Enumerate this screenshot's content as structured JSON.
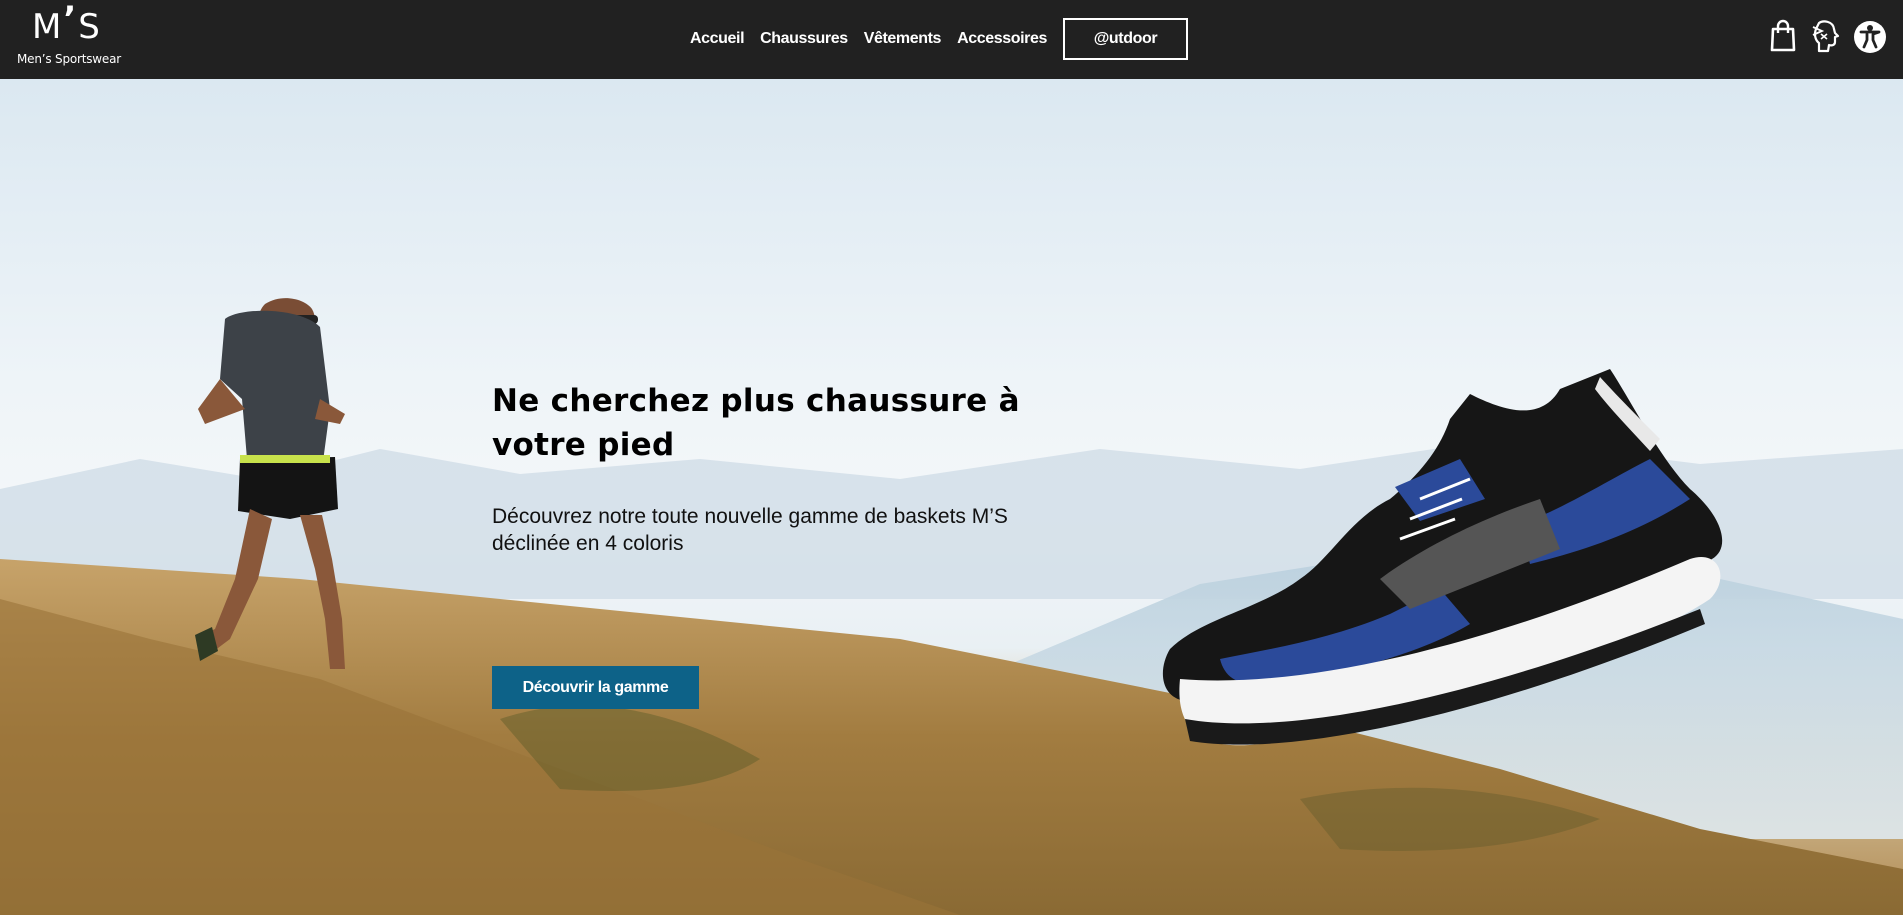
{
  "brand": {
    "mark_left": "M",
    "mark_quote": "’",
    "mark_right": "S",
    "tagline": "Men’s Sportswear"
  },
  "nav": {
    "items": [
      {
        "label": "Accueil"
      },
      {
        "label": "Chaussures"
      },
      {
        "label": "Vêtements"
      },
      {
        "label": "Accessoires"
      }
    ],
    "outdoor_label": "@utdoor"
  },
  "icons": [
    "shopping-bag-icon",
    "profile-icon",
    "accessibility-icon"
  ],
  "hero": {
    "headline": "Ne cherchez plus chaussure à votre pied",
    "subtext": "Découvrez notre toute nouvelle gamme de baskets M’S déclinée en 4 coloris",
    "cta_label": "Découvrir la gamme"
  },
  "colors": {
    "nav_bg": "#212121",
    "cta_bg": "#0d6288",
    "text": "#000000"
  }
}
